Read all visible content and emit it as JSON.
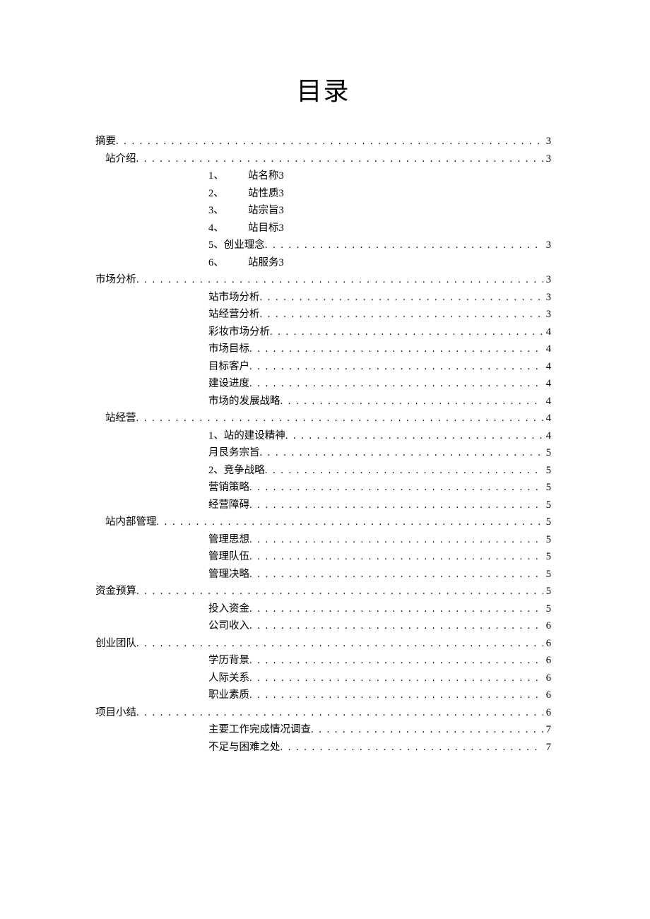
{
  "title": "目录",
  "toc": [
    {
      "indent": 0,
      "num": "",
      "label": "摘要",
      "page": "3",
      "leader": true
    },
    {
      "indent": 1,
      "num": "",
      "label": "站介绍",
      "page": "3",
      "leader": true
    },
    {
      "indent": 2,
      "num": "1、",
      "label": "站名称",
      "page": "3",
      "leader": false
    },
    {
      "indent": 2,
      "num": "2、",
      "label": "站性质",
      "page": "3",
      "leader": false
    },
    {
      "indent": 2,
      "num": "3、",
      "label": "站宗旨",
      "page": "3",
      "leader": false
    },
    {
      "indent": 2,
      "num": "4、",
      "label": "站目标",
      "page": "3",
      "leader": false
    },
    {
      "indent": 2,
      "num": "5、",
      "label": "创业理念",
      "page": "3",
      "leader": true
    },
    {
      "indent": 2,
      "num": "6、",
      "label": "站服务",
      "page": "3",
      "leader": false
    },
    {
      "indent": 0,
      "num": "",
      "label": "市场分析",
      "page": "3",
      "leader": true
    },
    {
      "indent": 3,
      "num": "",
      "label": "站市场分析",
      "page": "3",
      "leader": true
    },
    {
      "indent": 3,
      "num": "",
      "label": "站经营分析",
      "page": "3",
      "leader": true
    },
    {
      "indent": 3,
      "num": "",
      "label": "彩妆市场分析",
      "page": "4",
      "leader": true
    },
    {
      "indent": 3,
      "num": "",
      "label": "市场目标",
      "page": "4",
      "leader": true
    },
    {
      "indent": 3,
      "num": "",
      "label": "目标客户",
      "page": "4",
      "leader": true
    },
    {
      "indent": 3,
      "num": "",
      "label": "建设进度",
      "page": "4",
      "leader": true
    },
    {
      "indent": 3,
      "num": "",
      "label": "市场的发展战略",
      "page": "4",
      "leader": true
    },
    {
      "indent": 1,
      "num": "",
      "label": "站经营",
      "page": "4",
      "leader": true
    },
    {
      "indent": 2,
      "num": "1、",
      "label": "站的建设精神",
      "page": "4",
      "leader": true
    },
    {
      "indent": 3,
      "num": "",
      "label": "月艮务宗旨",
      "page": "5",
      "leader": true
    },
    {
      "indent": 2,
      "num": "2、",
      "label": "竞争战略",
      "page": "5",
      "leader": true
    },
    {
      "indent": 3,
      "num": "",
      "label": "营销策略",
      "page": "5",
      "leader": true
    },
    {
      "indent": 3,
      "num": "",
      "label": "经营障碍",
      "page": "5",
      "leader": true
    },
    {
      "indent": 1,
      "num": "",
      "label": "站内部管理",
      "page": "5",
      "leader": true
    },
    {
      "indent": 3,
      "num": "",
      "label": "管理思想",
      "page": "5",
      "leader": true
    },
    {
      "indent": 3,
      "num": "",
      "label": "管理队伍",
      "page": "5",
      "leader": true
    },
    {
      "indent": 3,
      "num": "",
      "label": "管理决略",
      "page": "5",
      "leader": true
    },
    {
      "indent": 0,
      "num": "",
      "label": "资金预算",
      "page": "5",
      "leader": true
    },
    {
      "indent": 3,
      "num": "",
      "label": "投入资金",
      "page": "5",
      "leader": true
    },
    {
      "indent": 3,
      "num": "",
      "label": "公司收入",
      "page": "6",
      "leader": true
    },
    {
      "indent": 0,
      "num": "",
      "label": "创业团队",
      "page": "6",
      "leader": true
    },
    {
      "indent": 3,
      "num": "",
      "label": "学历背景",
      "page": "6",
      "leader": true
    },
    {
      "indent": 3,
      "num": "",
      "label": "人际关系",
      "page": "6",
      "leader": true
    },
    {
      "indent": 3,
      "num": "",
      "label": "职业素质",
      "page": "6",
      "leader": true
    },
    {
      "indent": 0,
      "num": "",
      "label": "项目小结",
      "page": "6",
      "leader": true
    },
    {
      "indent": 3,
      "num": "",
      "label": "主要工作完成情况调查",
      "page": "7",
      "leader": true
    },
    {
      "indent": 3,
      "num": "",
      "label": "不足与困难之处",
      "page": "7",
      "leader": true
    }
  ]
}
